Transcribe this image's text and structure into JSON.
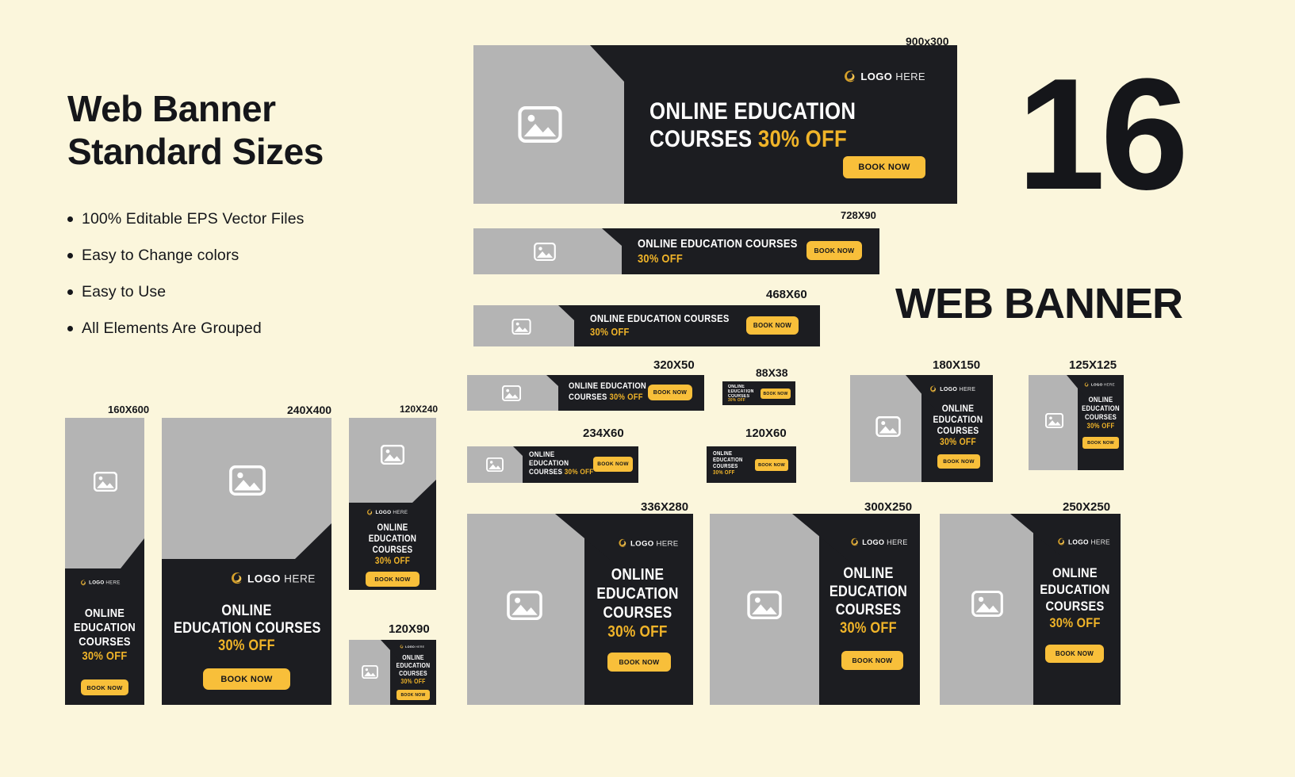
{
  "page": {
    "background": "#fbf6dc",
    "dark": "#1c1d21",
    "grey": "#b4b4b4",
    "accent": "#f8bf3a",
    "gold_text": "#f0b429",
    "ink": "#15161a"
  },
  "intro": {
    "title_line1": "Web Banner",
    "title_line2": "Standard Sizes",
    "features": [
      "100% Editable EPS Vector Files",
      "Easy to Change colors",
      "Easy to Use",
      "All Elements Are Grouped"
    ]
  },
  "hero": {
    "count": "16",
    "label": "WEB BANNER"
  },
  "common": {
    "logo_bold": "LOGO",
    "logo_light": "HERE",
    "line1": "ONLINE",
    "line2": "EDUCATION",
    "line3": "COURSES",
    "discount": "30% OFF",
    "cta": "BOOK NOW",
    "title_oneline": "ONLINE EDUCATION COURSES",
    "title_two_a": "ONLINE EDUCATION",
    "title_two_b": "COURSES",
    "image_placeholder": "image-placeholder"
  },
  "banners": [
    {
      "id": "b900x300",
      "size": "900x300"
    },
    {
      "id": "b728x90",
      "size": "728X90"
    },
    {
      "id": "b468x60",
      "size": "468X60"
    },
    {
      "id": "b320x50",
      "size": "320X50"
    },
    {
      "id": "b88x38",
      "size": "88X38"
    },
    {
      "id": "b234x60",
      "size": "234X60"
    },
    {
      "id": "b120x60",
      "size": "120X60"
    },
    {
      "id": "b180x150",
      "size": "180X150"
    },
    {
      "id": "b125x125",
      "size": "125X125"
    },
    {
      "id": "b160x600",
      "size": "160X600"
    },
    {
      "id": "b240x400",
      "size": "240X400"
    },
    {
      "id": "b120x240",
      "size": "120X240"
    },
    {
      "id": "b120x90",
      "size": "120X90"
    },
    {
      "id": "b336x280",
      "size": "336X280"
    },
    {
      "id": "b300x250",
      "size": "300X250"
    },
    {
      "id": "b250x250",
      "size": "250X250"
    }
  ]
}
